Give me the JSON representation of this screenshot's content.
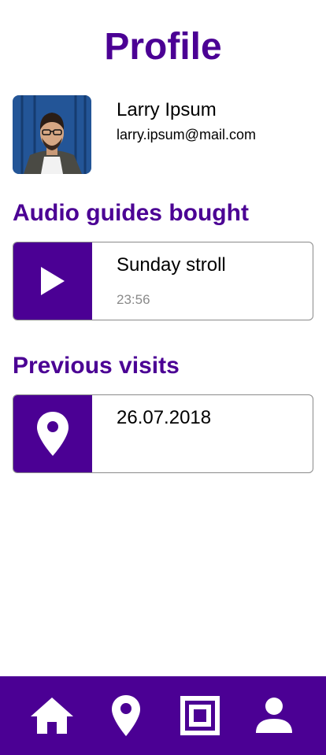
{
  "header": {
    "title": "Profile"
  },
  "user": {
    "name": "Larry Ipsum",
    "email": "larry.ipsum@mail.com",
    "avatar_icon": "profile-photo"
  },
  "audio_guides": {
    "section_title": "Audio guides bought",
    "items": [
      {
        "title": "Sunday stroll",
        "duration": "23:56",
        "icon": "play-icon"
      }
    ]
  },
  "previous_visits": {
    "section_title": "Previous visits",
    "items": [
      {
        "date": "26.07.2018",
        "icon": "location-pin-icon"
      }
    ]
  },
  "bottom_nav": {
    "items": [
      {
        "icon": "home-icon"
      },
      {
        "icon": "location-pin-icon"
      },
      {
        "icon": "qr-scan-icon"
      },
      {
        "icon": "user-icon"
      }
    ]
  },
  "colors": {
    "brand": "#4b0094",
    "text": "#000000",
    "muted": "#8a8a8a",
    "border": "#8a8a8a",
    "background": "#ffffff"
  }
}
